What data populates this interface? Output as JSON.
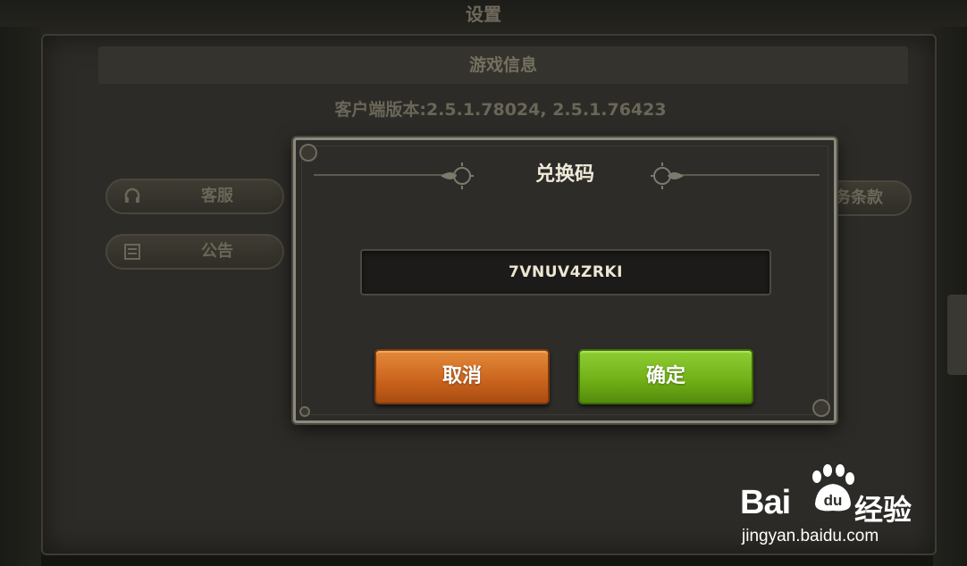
{
  "background": {
    "window_title": "设置",
    "section_title": "游戏信息",
    "version_text": "客户端版本:2.5.1.78024, 2.5.1.76423",
    "buttons": {
      "customer_service": {
        "label": "客服",
        "icon": "headset-icon"
      },
      "announcement": {
        "label": "公告",
        "icon": "notice-icon"
      },
      "service_terms": {
        "label": "务条款"
      }
    }
  },
  "dialog": {
    "title": "兑换码",
    "code_value": "7VNUV4ZRKI",
    "cancel_label": "取消",
    "confirm_label": "确定",
    "colors": {
      "cancel": "#d2712a",
      "confirm": "#7dbd22",
      "field_bg": "#1c1b19"
    }
  },
  "watermark": {
    "brand": "Bai",
    "paw_text": "du",
    "suffix": "经验",
    "url": "jingyan.baidu.com"
  }
}
